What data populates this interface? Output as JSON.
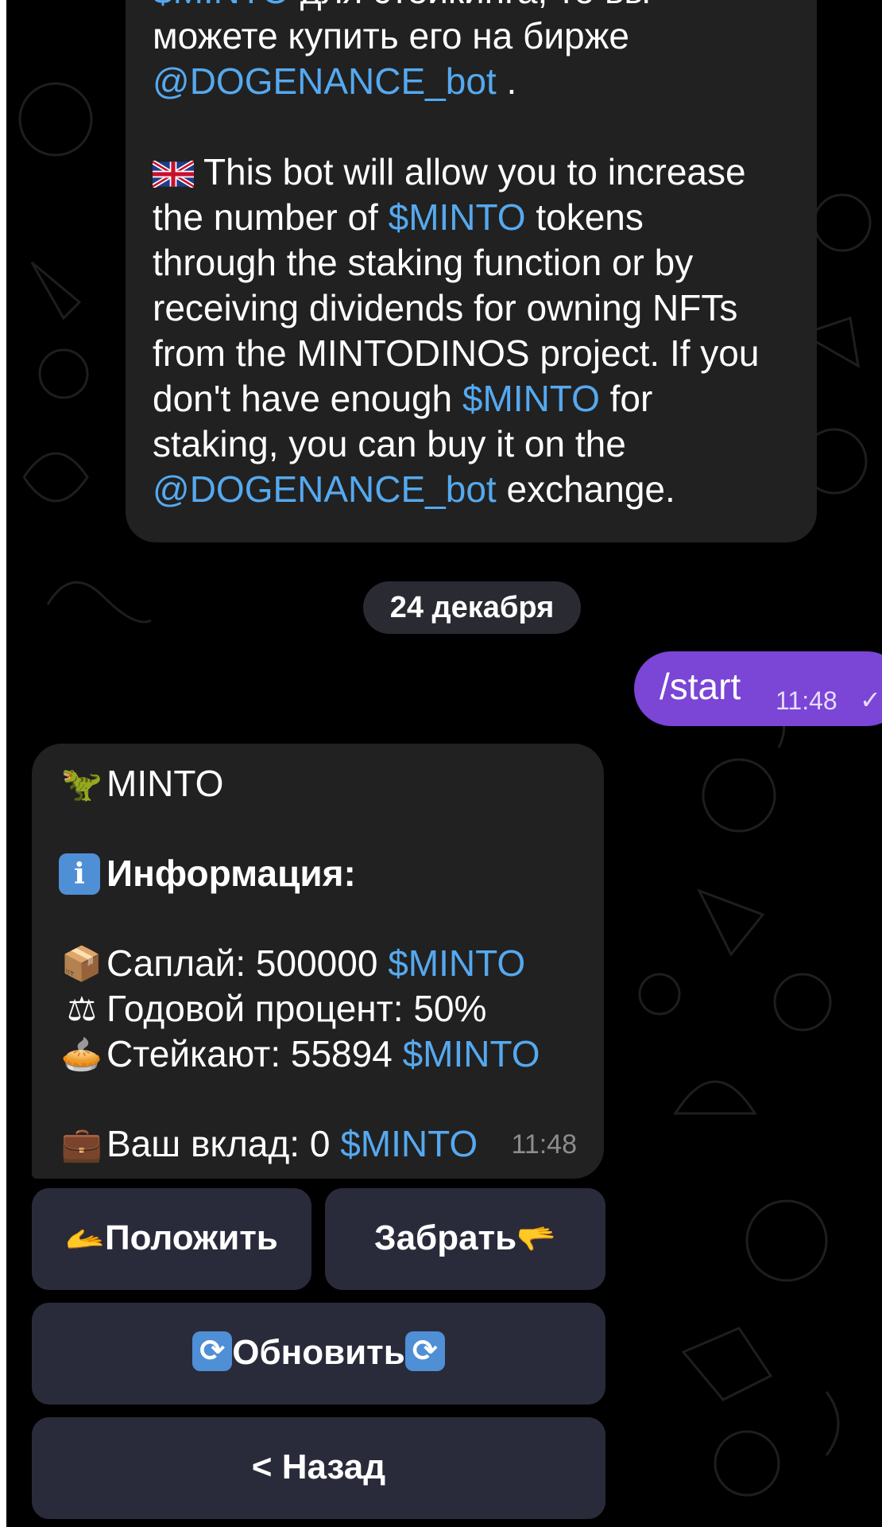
{
  "top_message": {
    "line_ru_1": "$MINTO для стейкинга, то вы",
    "line_ru_2": "можете купить его на бирже",
    "line_ru_3_link": "@DOGENANCE_bot",
    "line_ru_3_tail": " .",
    "flag_icon": "uk-flag-icon",
    "line_en_1": " This bot will allow you to increase",
    "line_en_2_pre": "the number of ",
    "line_en_2_link": "$MINTO",
    "line_en_2_post": " tokens",
    "line_en_3": "through the staking function or by",
    "line_en_4": "receiving dividends for owning NFTs",
    "line_en_5": "from the MINTODINOS project. If you",
    "line_en_6_pre": "don't have enough ",
    "line_en_6_link": "$MINTO",
    "line_en_6_post": " for",
    "line_en_7": "staking, you can buy it on the",
    "line_en_8_link": "@DOGENANCE_bot",
    "line_en_8_post": " exchange."
  },
  "date_separator": "24 декабря",
  "outgoing": {
    "text": "/start",
    "time": "11:48",
    "status_icon": "double-check-icon"
  },
  "bot_message": {
    "title": "MINTO",
    "title_icon": "dinosaur-icon",
    "info_icon": "info-icon",
    "info_heading": "Информация:",
    "supply_icon": "package-icon",
    "supply_label": "Саплай: 500000 ",
    "supply_token": "$MINTO",
    "rate_icon": "scales-icon",
    "rate_label": "Годовой процент: 50%",
    "staked_icon": "pie-icon",
    "staked_label": "Стейкают: 55894 ",
    "staked_token": "$MINTO",
    "deposit_icon": "briefcase-icon",
    "deposit_label": "Ваш вклад: 0 ",
    "deposit_token": "$MINTO",
    "time": "11:48"
  },
  "keyboard": {
    "deposit_label": "Положить",
    "deposit_icon": "hand-give-icon",
    "withdraw_label": "Забрать",
    "withdraw_icon": "hand-take-icon",
    "refresh_label": "Обновить",
    "refresh_icon": "refresh-icon",
    "back_label": "< Назад"
  },
  "colors": {
    "background": "#000000",
    "bubble": "#212121",
    "link": "#55a9ef",
    "outgoing_bubble": "#7b45d6",
    "keyboard_button": "#2a2b3a"
  }
}
